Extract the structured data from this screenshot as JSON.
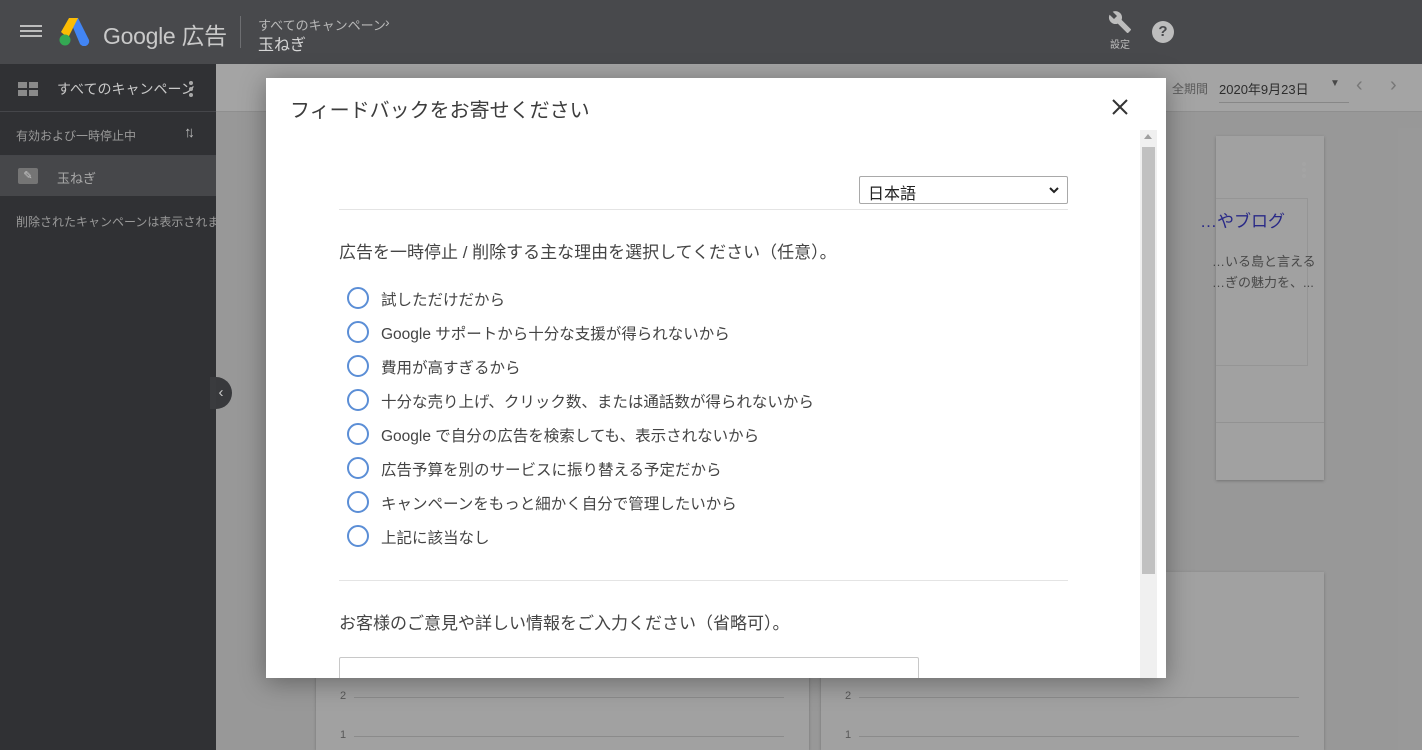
{
  "topbar": {
    "brand": "Google 広告",
    "breadcrumb_parent": "すべてのキャンペーン",
    "breadcrumb_chevron": "›",
    "breadcrumb_current": "玉ねぎ",
    "settings_label": "設定",
    "help_glyph": "?"
  },
  "sidebar": {
    "title": "すべてのキャンペーン",
    "filter_label": "有効および一時停止中",
    "sort_glyph": "↑↓",
    "items": [
      {
        "label": "玉ねぎ",
        "icon": "search-campaign-icon",
        "selected": true
      }
    ],
    "note": "削除されたキャンペーンは表示されません",
    "collapse_glyph": "‹"
  },
  "main": {
    "period_label": "全期間",
    "date_range": "2020年9月23日",
    "date_caret": "▼",
    "prev_glyph": "‹",
    "next_glyph": "›",
    "ad_card": {
      "headline_partial": "…やブログ",
      "description_line1": "…いる島と言える",
      "description_line2": "…ぎの魅力を、..."
    },
    "charts": [
      {
        "y_ticks": [
          "2",
          "1"
        ]
      },
      {
        "y_ticks": [
          "2",
          "1"
        ]
      }
    ]
  },
  "modal": {
    "title": "フィードバックをお寄せください",
    "close_icon": "close-icon",
    "language": {
      "selected": "日本語"
    },
    "reason_question": "広告を一時停止 / 削除する主な理由を選択してください（任意）。",
    "reasons": [
      {
        "label": "試しただけだから",
        "checked": false
      },
      {
        "label": "Google サポートから十分な支援が得られないから",
        "checked": false
      },
      {
        "label": "費用が高すぎるから",
        "checked": false
      },
      {
        "label": "十分な売り上げ、クリック数、または通話数が得られないから",
        "checked": false
      },
      {
        "label": "Google で自分の広告を検索しても、表示されないから",
        "checked": false
      },
      {
        "label": "広告予算を別のサービスに振り替える予定だから",
        "checked": false
      },
      {
        "label": "キャンペーンをもっと細かく自分で管理したいから",
        "checked": false
      },
      {
        "label": "上記に該当なし",
        "checked": false
      }
    ],
    "comment_question": "お客様のご意見や詳しい情報をご入力ください（省略可）。",
    "comment_value": "",
    "comment_placeholder": ""
  },
  "colors": {
    "topbar": "#48494c",
    "sidebar": "#303134",
    "radio_border": "#5b8ed6",
    "modal_bg": "#ffffff"
  }
}
